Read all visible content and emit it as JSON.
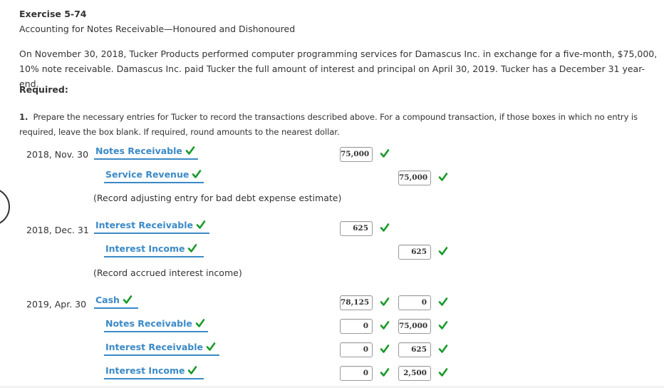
{
  "exercise": {
    "title": "Exercise 5-74",
    "subtitle": "Accounting for Notes Receivable—Honoured and Dishonoured",
    "description": "On November 30, 2018, Tucker Products performed computer programming services for Damascus Inc. in exchange for a five-month, $75,000, 10% note receivable. Damascus Inc. paid Tucker the full amount of interest and principal on April 30, 2019. Tucker has a December 31 year-end.",
    "required_label": "Required:",
    "question_number": "1.",
    "question_text": "Prepare the necessary entries for Tucker to record the transactions described above. For a compound transaction, if those boxes in which no entry is required, leave the box blank. If required, round amounts to the nearest dollar."
  },
  "colors": {
    "account_blue": "#3b8ac7",
    "check_green": "#1a9a2a",
    "text": "#333333"
  },
  "icons": {
    "correct": "checkmark-icon"
  },
  "entries": [
    {
      "date": "2018, Nov. 30",
      "lines": [
        {
          "account": "Notes Receivable",
          "debit": "75,000",
          "credit": null
        },
        {
          "account": "Service Revenue",
          "debit": null,
          "credit": "75,000"
        }
      ],
      "note": "(Record adjusting entry for bad debt expense estimate)"
    },
    {
      "date": "2018, Dec. 31",
      "lines": [
        {
          "account": "Interest Receivable",
          "debit": "625",
          "credit": null
        },
        {
          "account": "Interest Income",
          "debit": null,
          "credit": "625"
        }
      ],
      "note": "(Record accrued interest income)"
    },
    {
      "date": "2019, Apr. 30",
      "lines": [
        {
          "account": "Cash",
          "debit": "78,125",
          "credit": "0"
        },
        {
          "account": "Notes Receivable",
          "debit": "0",
          "credit": "75,000"
        },
        {
          "account": "Interest Receivable",
          "debit": "0",
          "credit": "625"
        },
        {
          "account": "Interest Income",
          "debit": "0",
          "credit": "2,500"
        }
      ],
      "note": null
    }
  ]
}
